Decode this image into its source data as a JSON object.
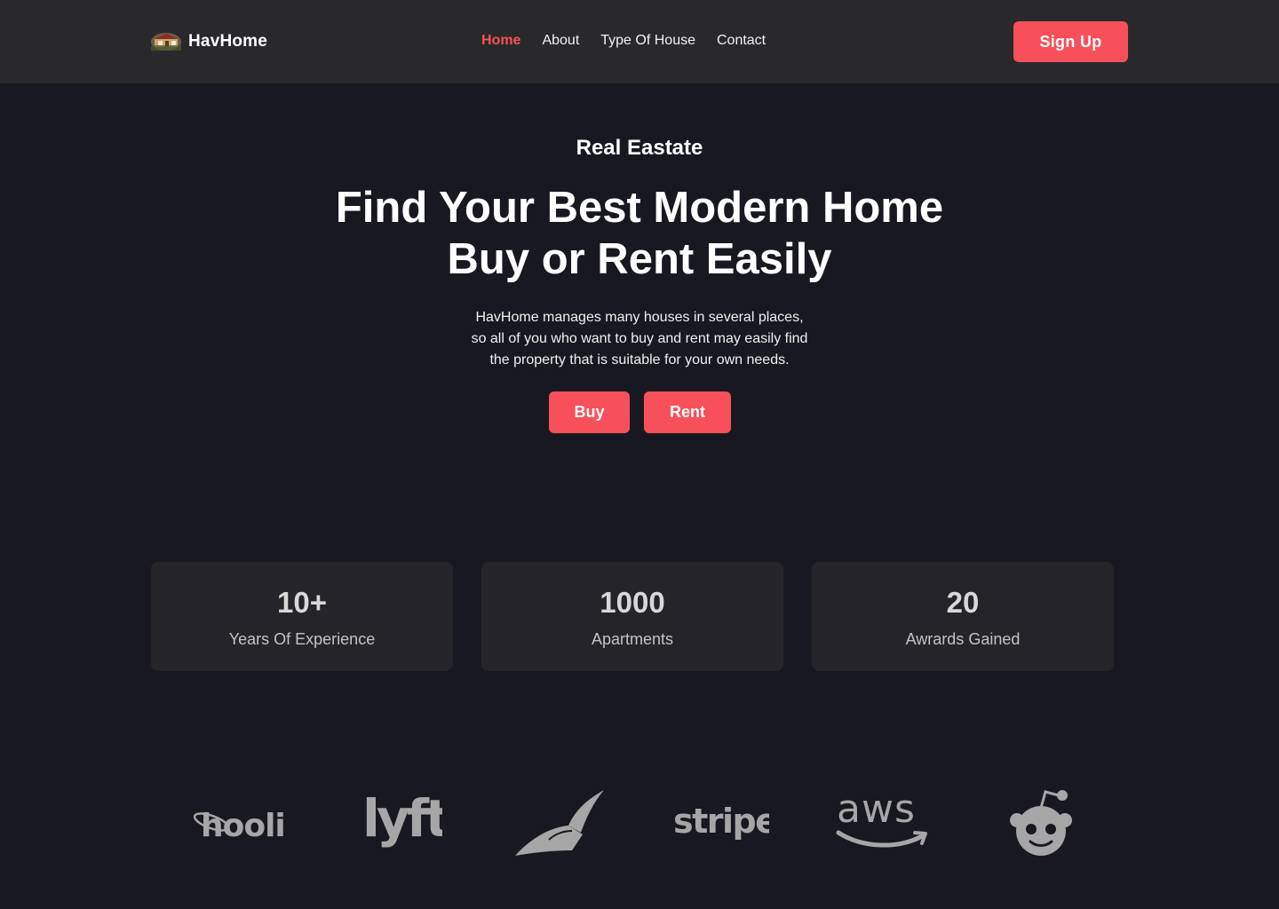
{
  "brand": {
    "name": "HavHome",
    "logo_icon": "house-photo-icon"
  },
  "nav": {
    "items": [
      {
        "label": "Home",
        "active": true
      },
      {
        "label": "About",
        "active": false
      },
      {
        "label": "Type Of House",
        "active": false
      },
      {
        "label": "Contact",
        "active": false
      }
    ],
    "signup_label": "Sign Up"
  },
  "hero": {
    "eyebrow": "Real Eastate",
    "headline_lines": [
      "Find Your Best Modern Home",
      "Buy or Rent Easily"
    ],
    "description_lines": [
      "HavHome manages many houses in several places,",
      "so all of you who want to buy and rent may easily find",
      "the property that is suitable for your own needs."
    ],
    "buy_label": "Buy",
    "rent_label": "Rent"
  },
  "stats": [
    {
      "value": "10+",
      "label": "Years Of Experience"
    },
    {
      "value": "1000",
      "label": "Apartments"
    },
    {
      "value": "20",
      "label": "Awrards Gained"
    }
  ],
  "partners": {
    "hooli": "hooli",
    "lyft": "lyft",
    "stripe": "stripe",
    "aws": "aws",
    "icons": [
      "hooli-logo-icon",
      "lyft-logo-icon",
      "pied-piper-logo-icon",
      "stripe-logo-icon",
      "aws-logo-icon",
      "reddit-logo-icon"
    ]
  },
  "colors": {
    "background": "#181920",
    "navbar": "#29292c",
    "accent": "#f8505a",
    "card": "#252529",
    "logo_gray": "#a6a6a6"
  }
}
